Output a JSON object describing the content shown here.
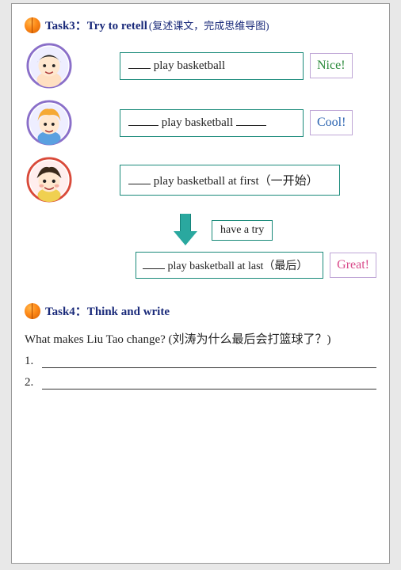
{
  "task3": {
    "title": "Task3：Try to retell",
    "subtitle": "(复述课文，完成思维导图)",
    "rows": [
      {
        "text_before": "",
        "text_mid": " play basketball",
        "text_after": "",
        "badge": "Nice!",
        "badge_class": "nice"
      },
      {
        "text_before": "",
        "text_mid": " play basketball ",
        "text_after": "",
        "badge": "Cool!",
        "badge_class": "cool"
      },
      {
        "text": " play basketball at first（一开始）"
      }
    ],
    "try_text": "have a try",
    "last_row": {
      "text": " play basketball at last（最后）",
      "badge": "Great!",
      "badge_class": "great"
    }
  },
  "task4": {
    "title": "Task4：Think and write",
    "question": "What makes Liu Tao change? (刘涛为什么最后会打篮球了？)",
    "answers": [
      "1.",
      "2."
    ]
  }
}
